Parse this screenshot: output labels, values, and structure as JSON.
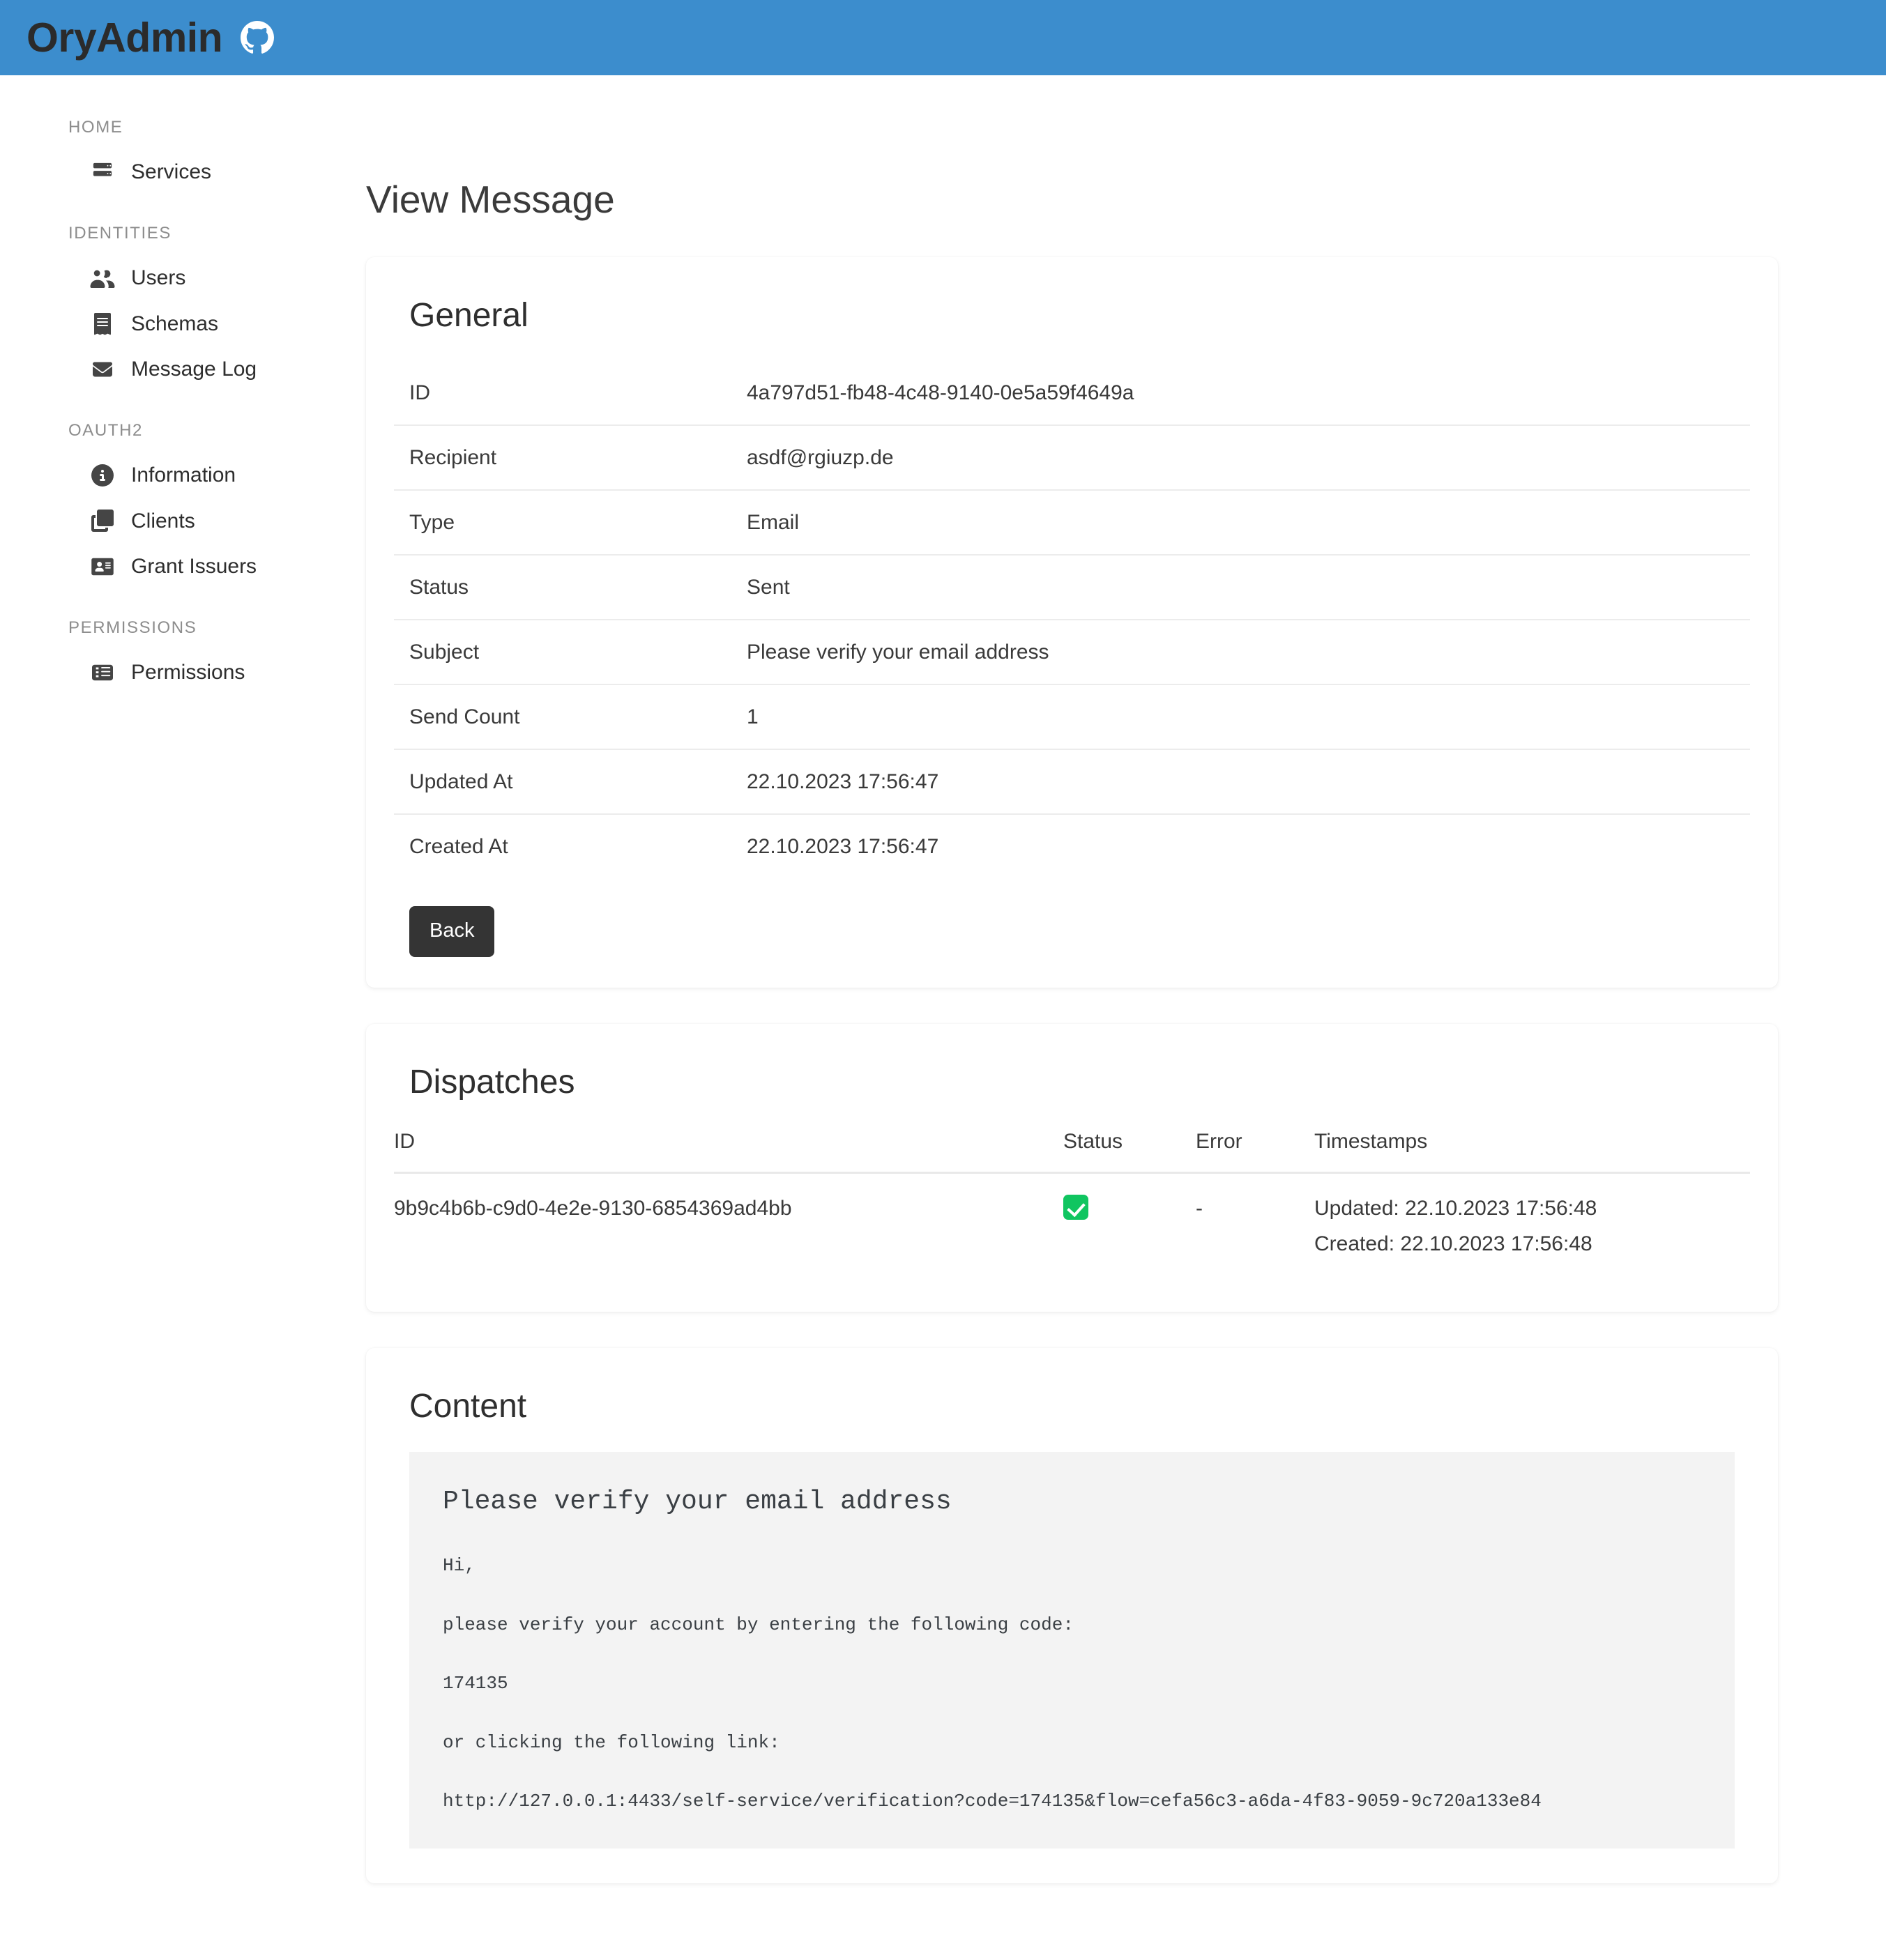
{
  "navbar": {
    "brand": "OryAdmin",
    "github_icon": "github-icon"
  },
  "sidebar": {
    "sections": [
      {
        "title": "HOME",
        "items": [
          {
            "label": "Services",
            "icon": "server-icon"
          }
        ]
      },
      {
        "title": "IDENTITIES",
        "items": [
          {
            "label": "Users",
            "icon": "users-icon"
          },
          {
            "label": "Schemas",
            "icon": "schema-icon"
          },
          {
            "label": "Message Log",
            "icon": "envelope-icon"
          }
        ]
      },
      {
        "title": "OAUTH2",
        "items": [
          {
            "label": "Information",
            "icon": "info-circle-icon"
          },
          {
            "label": "Clients",
            "icon": "clients-icon"
          },
          {
            "label": "Grant Issuers",
            "icon": "id-card-icon"
          }
        ]
      },
      {
        "title": "PERMISSIONS",
        "items": [
          {
            "label": "Permissions",
            "icon": "list-table-icon"
          }
        ]
      }
    ]
  },
  "page": {
    "title": "View Message"
  },
  "general": {
    "heading": "General",
    "rows": [
      {
        "key": "ID",
        "value": "4a797d51-fb48-4c48-9140-0e5a59f4649a"
      },
      {
        "key": "Recipient",
        "value": "asdf@rgiuzp.de"
      },
      {
        "key": "Type",
        "value": "Email"
      },
      {
        "key": "Status",
        "value": "Sent"
      },
      {
        "key": "Subject",
        "value": "Please verify your email address"
      },
      {
        "key": "Send Count",
        "value": "1"
      },
      {
        "key": "Updated At",
        "value": "22.10.2023 17:56:47"
      },
      {
        "key": "Created At",
        "value": "22.10.2023 17:56:47"
      }
    ],
    "back_label": "Back"
  },
  "dispatches": {
    "heading": "Dispatches",
    "columns": [
      "ID",
      "Status",
      "Error",
      "Timestamps"
    ],
    "rows": [
      {
        "id": "9b9c4b6b-c9d0-4e2e-9130-6854369ad4bb",
        "status_icon": "green-check-icon",
        "error": "-",
        "updated": "Updated: 22.10.2023 17:56:48",
        "created": "Created: 22.10.2023 17:56:48"
      }
    ]
  },
  "content": {
    "heading": "Content",
    "subject": "Please verify your email address",
    "lines": [
      "Hi,",
      "please verify your account by entering the following code:",
      "174135",
      "or clicking the following link:",
      "http://127.0.0.1:4433/self-service/verification?code=174135&flow=cefa56c3-a6da-4f83-9059-9c720a133e84"
    ]
  },
  "colors": {
    "navbar_blue": "#3c8dcd",
    "success_green": "#10c560",
    "button_dark": "#343434",
    "content_bg": "#f3f3f3"
  }
}
